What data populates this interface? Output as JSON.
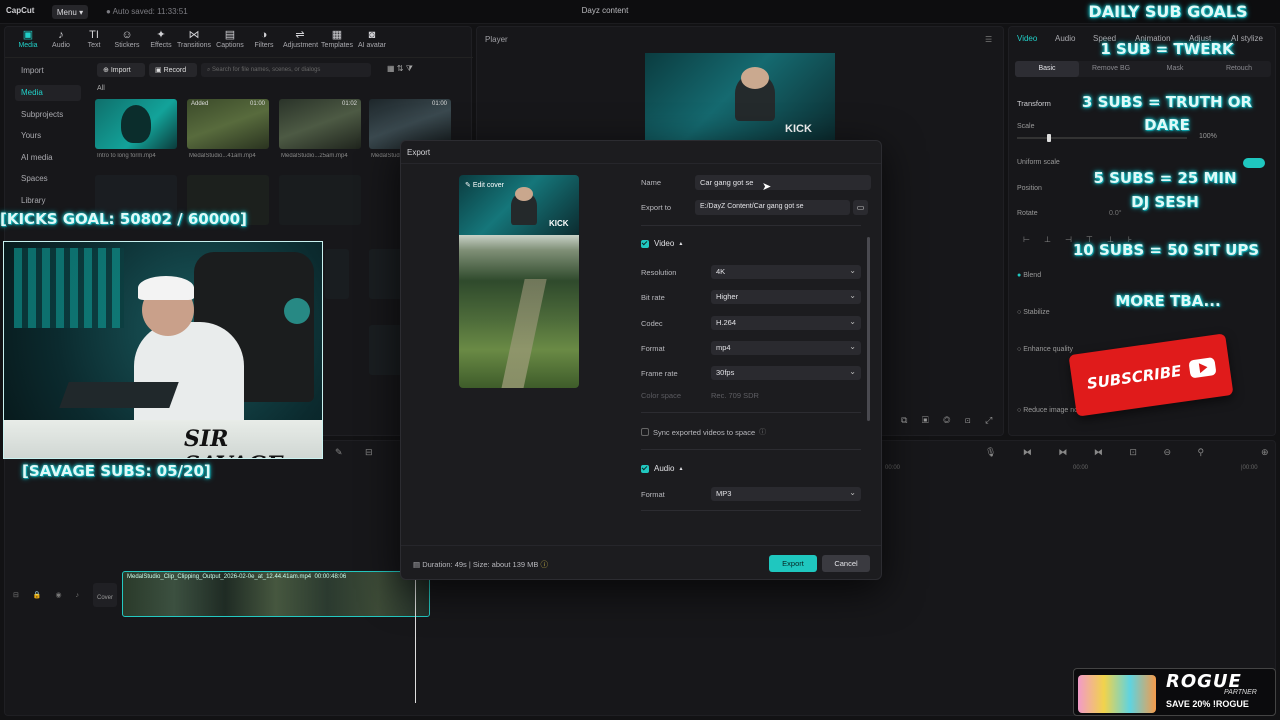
{
  "window": {
    "logo": "CapCut",
    "menu_label": "Menu",
    "autosave": "Auto saved: 11:33:51",
    "title": "Dayz content"
  },
  "media_toolbar": [
    {
      "label": "Media",
      "icon": "media-icon",
      "glyph": "▣"
    },
    {
      "label": "Audio",
      "icon": "audio-icon",
      "glyph": "♪"
    },
    {
      "label": "Text",
      "icon": "text-icon",
      "glyph": "TI"
    },
    {
      "label": "Stickers",
      "icon": "sticker-icon",
      "glyph": "☺"
    },
    {
      "label": "Effects",
      "icon": "effects-icon",
      "glyph": "✦"
    },
    {
      "label": "Transitions",
      "icon": "transitions-icon",
      "glyph": "⋈"
    },
    {
      "label": "Captions",
      "icon": "captions-icon",
      "glyph": "▤"
    },
    {
      "label": "Filters",
      "icon": "filters-icon",
      "glyph": "◑"
    },
    {
      "label": "Adjustment",
      "icon": "adjustment-icon",
      "glyph": "⇌"
    },
    {
      "label": "Templates",
      "icon": "templates-icon",
      "glyph": "▦"
    },
    {
      "label": "AI avatar",
      "icon": "ai-avatar-icon",
      "glyph": "◙"
    }
  ],
  "media_sidebar": [
    "Import",
    "Media",
    "Subprojects",
    "Yours",
    "AI media",
    "Spaces",
    "Library"
  ],
  "media_header": {
    "import": "Import",
    "record": "Record",
    "search_placeholder": "Search for file names, scenes, or dialogs",
    "all_label": "All"
  },
  "media_items": [
    {
      "label": "Intro to long form.mp4",
      "duration": "",
      "tag": ""
    },
    {
      "label": "MedalStudio...41am.mp4",
      "duration": "01:00",
      "tag": "Added"
    },
    {
      "label": "MedalStudio...25am.mp4",
      "duration": "01:02",
      "tag": ""
    },
    {
      "label": "MedalStudio...mp4",
      "duration": "01:00",
      "tag": ""
    }
  ],
  "player": {
    "title": "Player"
  },
  "properties": {
    "tabs": [
      "Video",
      "Audio",
      "Speed",
      "Animation",
      "Adjust",
      "AI stylize"
    ],
    "subtabs": [
      "Basic",
      "Remove BG",
      "Mask",
      "Retouch"
    ],
    "transform": "Transform",
    "scale": "Scale",
    "scale_value": "100%",
    "uniform_scale": "Uniform scale",
    "position": "Position",
    "rotate": "Rotate",
    "rotate_value": "0.0°",
    "blend": "Blend",
    "stabilize": "Stabilize",
    "enhance": "Enhance quality",
    "reduce": "Reduce image noise"
  },
  "export_dialog": {
    "title": "Export",
    "edit_cover": "Edit cover",
    "name_label": "Name",
    "name_value": "Car gang got se",
    "export_to_label": "Export to",
    "export_to_value": "E:/DayZ Content/Car gang got se",
    "video_section": "Video",
    "rows": [
      {
        "label": "Resolution",
        "value": "4K"
      },
      {
        "label": "Bit rate",
        "value": "Higher"
      },
      {
        "label": "Codec",
        "value": "H.264"
      },
      {
        "label": "Format",
        "value": "mp4"
      },
      {
        "label": "Frame rate",
        "value": "30fps"
      }
    ],
    "color_space_label": "Color space",
    "color_space_value": "Rec. 709 SDR",
    "sync_label": "Sync exported videos to space",
    "audio_section": "Audio",
    "audio_format_label": "Format",
    "audio_format_value": "MP3",
    "duration_info": "Duration: 49s | Size: about 139 MB",
    "export_button": "Export",
    "cancel_button": "Cancel"
  },
  "timeline": {
    "clip_label": "MedalStudio_Clip_Clipping_Output_2026-02-0e_at_12.44.41am.mp4",
    "clip_duration": "00:00:48:06",
    "cover_label": "Cover",
    "marks": [
      "00:00",
      "00:00",
      "|00:00"
    ]
  },
  "overlay": {
    "sub_goals_title": "DAILY SUB GOALS",
    "goals": [
      "1 SUB = TWERK",
      "3 SUBS = TRUTH OR DARE",
      "5 SUBS = 25 MIN DJ SESH",
      "10 SUBS = 50 SIT UPS",
      "MORE TBA..."
    ],
    "kicks_goal": "[KICKS GOAL:  50802 / 60000]",
    "savage_subs": "[SAVAGE SUBS: 05/20]",
    "webcam_name": "SIR SAVAGE",
    "subscribe": "SUBSCRIBE",
    "rogue_brand": "ROGUE",
    "rogue_sub": "PARTNER",
    "rogue_promo": "SAVE 20% !ROGUE",
    "player_badge": "KICK"
  }
}
